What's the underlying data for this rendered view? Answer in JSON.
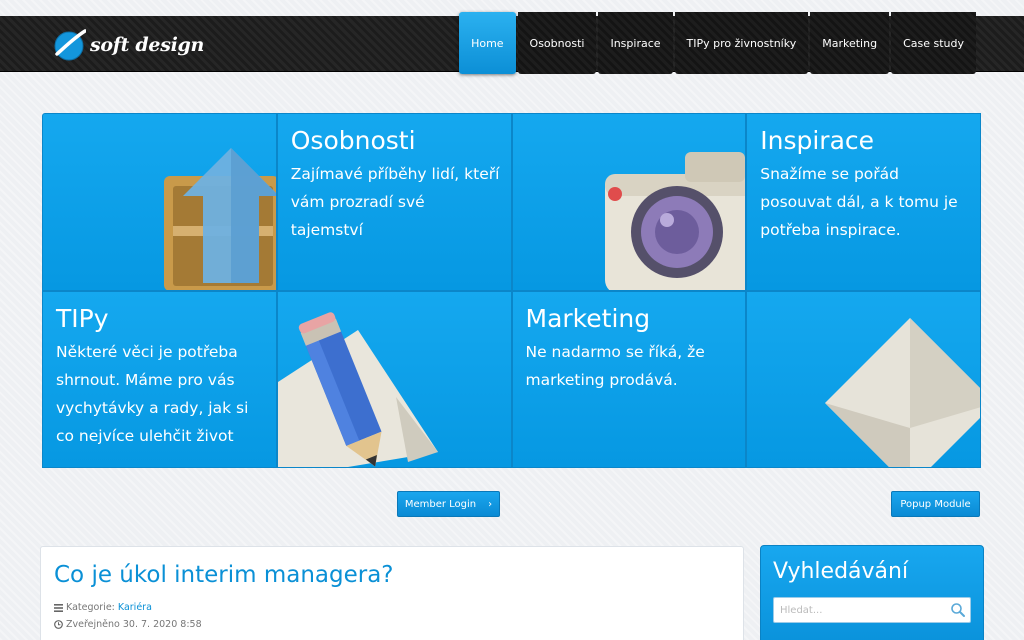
{
  "header": {
    "logo_text": "soft design",
    "nav": [
      {
        "label": "Home",
        "active": true
      },
      {
        "label": "Osobnosti"
      },
      {
        "label": "Inspirace"
      },
      {
        "label": "TIPy pro živnostníky"
      },
      {
        "label": "Marketing"
      },
      {
        "label": "Case study"
      }
    ]
  },
  "tiles": {
    "osobnosti": {
      "title": "Osobnosti",
      "text": "Zajímavé příběhy lidí, kteří vám prozradí své tajemství"
    },
    "inspirace": {
      "title": "Inspirace",
      "text": "Snažíme se pořád posouvat dál, a k tomu je potřeba inspirace."
    },
    "tipy": {
      "title": "TIPy",
      "text": "Některé věci je potřeba shrnout. Máme pro vás vychytávky a rady, jak si co nejvíce ulehčit život"
    },
    "marketing": {
      "title": "Marketing",
      "text": "Ne nadarmo se říká, že marketing prodává."
    }
  },
  "buttons": {
    "member_login": "Member Login",
    "member_login_arrow": "›",
    "popup_module": "Popup Module"
  },
  "article": {
    "title": "Co je úkol interim managera?",
    "category_label": "Kategorie:",
    "category_value": "Kariéra",
    "published": "Zveřejněno 30. 7. 2020 8:58"
  },
  "search": {
    "title": "Vyhledávání",
    "placeholder": "Hledat..."
  },
  "colors": {
    "accent": "#0a90d6",
    "tile_blue": "#0a9be3",
    "header_bg": "#1f1f1f"
  }
}
